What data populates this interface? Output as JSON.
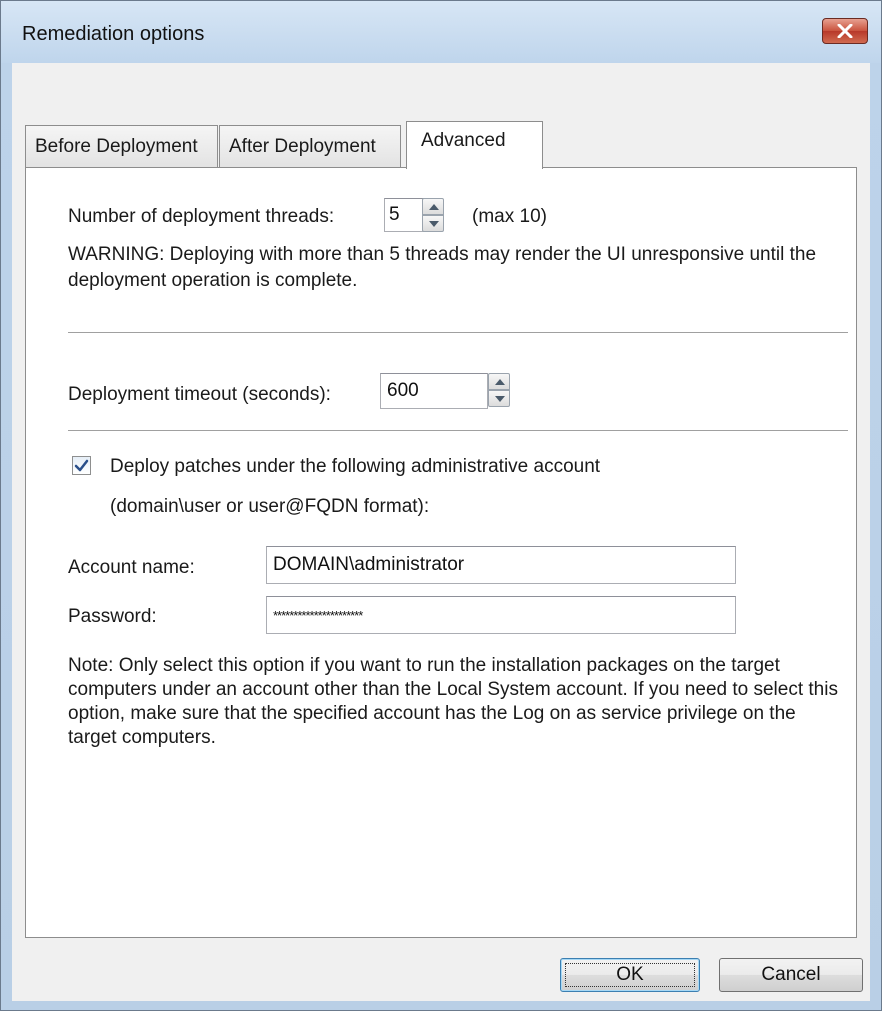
{
  "window": {
    "title": "Remediation options"
  },
  "tabs": [
    {
      "label": "Before Deployment",
      "active": false
    },
    {
      "label": "After Deployment",
      "active": false
    },
    {
      "label": "Advanced",
      "active": true
    }
  ],
  "advanced": {
    "threads_label": "Number of deployment threads:",
    "threads_value": "5",
    "threads_max": "(max 10)",
    "warning": "WARNING: Deploying with more than 5 threads may render the UI unresponsive until the deployment operation is complete.",
    "timeout_label": "Deployment timeout (seconds):",
    "timeout_value": "600",
    "admin_checkbox_label": "Deploy patches under the following administrative account",
    "admin_checkbox_checked": true,
    "admin_format_hint": "(domain\\user or user@FQDN format):",
    "account_label": "Account name:",
    "account_value": "DOMAIN\\administrator",
    "password_label": "Password:",
    "password_value": "**********************",
    "note": "Note: Only select this option if you want to run the installation packages on the target computers under an account other than the Local System account. If you need to select this option, make sure that the specified account has the Log on as service privilege on the target computers."
  },
  "buttons": {
    "ok": "OK",
    "cancel": "Cancel"
  },
  "icons": {
    "close": "close-icon",
    "spin_up": "arrow-up-icon",
    "spin_down": "arrow-down-icon",
    "check": "checkmark-icon"
  },
  "colors": {
    "title_bar": "#bfd5ec",
    "close_button": "#c9523d",
    "dialog_bg": "#f0f0f0",
    "default_button_border": "#3c7fb1"
  }
}
